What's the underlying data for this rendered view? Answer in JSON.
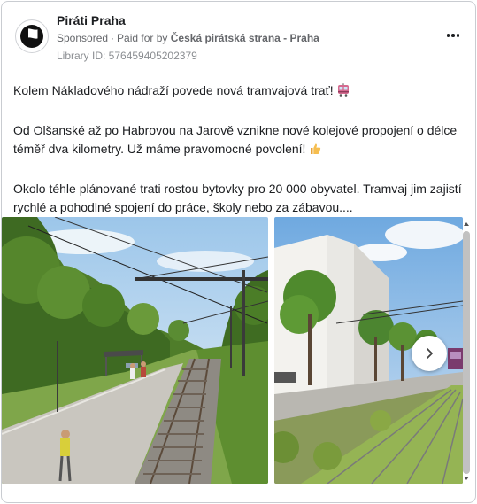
{
  "page": {
    "name": "Piráti Praha"
  },
  "ad": {
    "sponsored": "Sponsored",
    "paid_for_by": "Paid for by",
    "payer": "Česká pirátská strana - Praha",
    "library_id": "Library ID: 576459405202379"
  },
  "post": {
    "line1": "Kolem Nákladového nádraží povede nová tramvajová trať!",
    "line2": "Od Olšanské až po Habrovou na Jarově vznikne nové kolejové propojení o délce téměř dva kilometry. Už máme pravomocné povolení!",
    "line3": "Okolo téhle plánované trati rostou bytovky pro 20 000 obyvatel. Tramvaj jim zajistí rychlé a pohodlné spojení do práce, školy nebo za zábavou...."
  },
  "icons": {
    "avatar": "pirate-flag-icon",
    "more": "more-horizontal-icon",
    "tram": "tram-emoji-icon",
    "thumb": "thumbs-up-emoji-icon",
    "next": "chevron-right-icon"
  },
  "colors": {
    "text": "#1c1e21",
    "meta": "#65676b",
    "scrollbar": "#c1c1c1"
  }
}
